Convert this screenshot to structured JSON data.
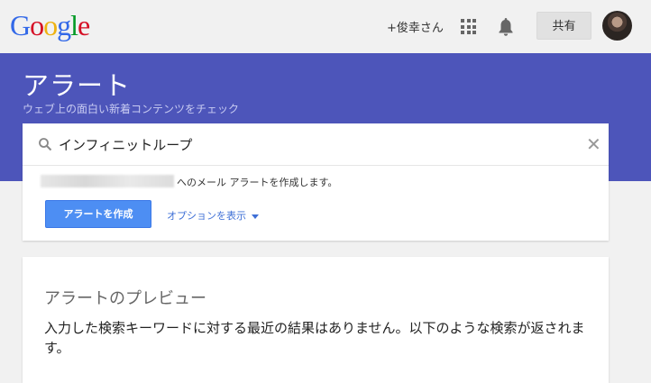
{
  "topbar": {
    "logo_letters": [
      {
        "ch": "G",
        "color": "#3369e8"
      },
      {
        "ch": "o",
        "color": "#d50f25"
      },
      {
        "ch": "o",
        "color": "#eeb211"
      },
      {
        "ch": "g",
        "color": "#3369e8"
      },
      {
        "ch": "l",
        "color": "#009925"
      },
      {
        "ch": "e",
        "color": "#d50f25"
      }
    ],
    "user_link": "+俊幸さん",
    "apps_icon": "apps-grid-icon",
    "notifications_icon": "bell-icon",
    "share_label": "共有",
    "avatar_icon": "user-avatar"
  },
  "header": {
    "title": "アラート",
    "subtitle": "ウェブ上の面白い新着コンテンツをチェック",
    "background": "#4d55ba"
  },
  "search": {
    "value": "インフィニットループ",
    "clear_icon": "close-icon",
    "search_icon": "search-icon"
  },
  "alert_form": {
    "email_note": "へのメール アラートを作成します。",
    "create_button": "アラートを作成",
    "options_link": "オプションを表示",
    "accent": "#4d8ef3"
  },
  "preview": {
    "title": "アラートのプレビュー",
    "message": "入力した検索キーワードに対する最近の結果はありません。以下のような検索が返されます。"
  }
}
